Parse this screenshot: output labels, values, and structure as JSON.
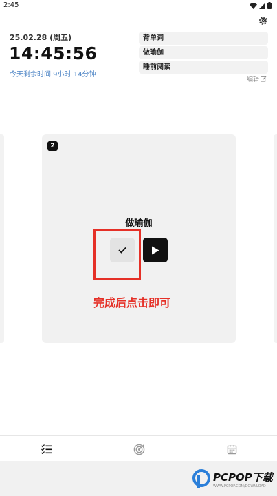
{
  "status_bar": {
    "time": "2:45"
  },
  "header": {
    "date": "25.02.28 (周五)",
    "clock": "14:45:56",
    "remaining": "今天剩余时间 9小时 14分钟"
  },
  "tasks": [
    {
      "label": "背单词"
    },
    {
      "label": "做瑜伽"
    },
    {
      "label": "睡前阅读"
    }
  ],
  "edit_label": "编辑",
  "card": {
    "badge": "2",
    "title": "做瑜伽"
  },
  "annotation": "完成后点击即可",
  "watermark": {
    "text": "PCPOP下载",
    "sub": "WWW.PCPOP.COM/DOWNLOAD"
  },
  "colors": {
    "accent": "#4f86c6",
    "annotation": "#e53027",
    "card_bg": "#f1f1f1"
  }
}
